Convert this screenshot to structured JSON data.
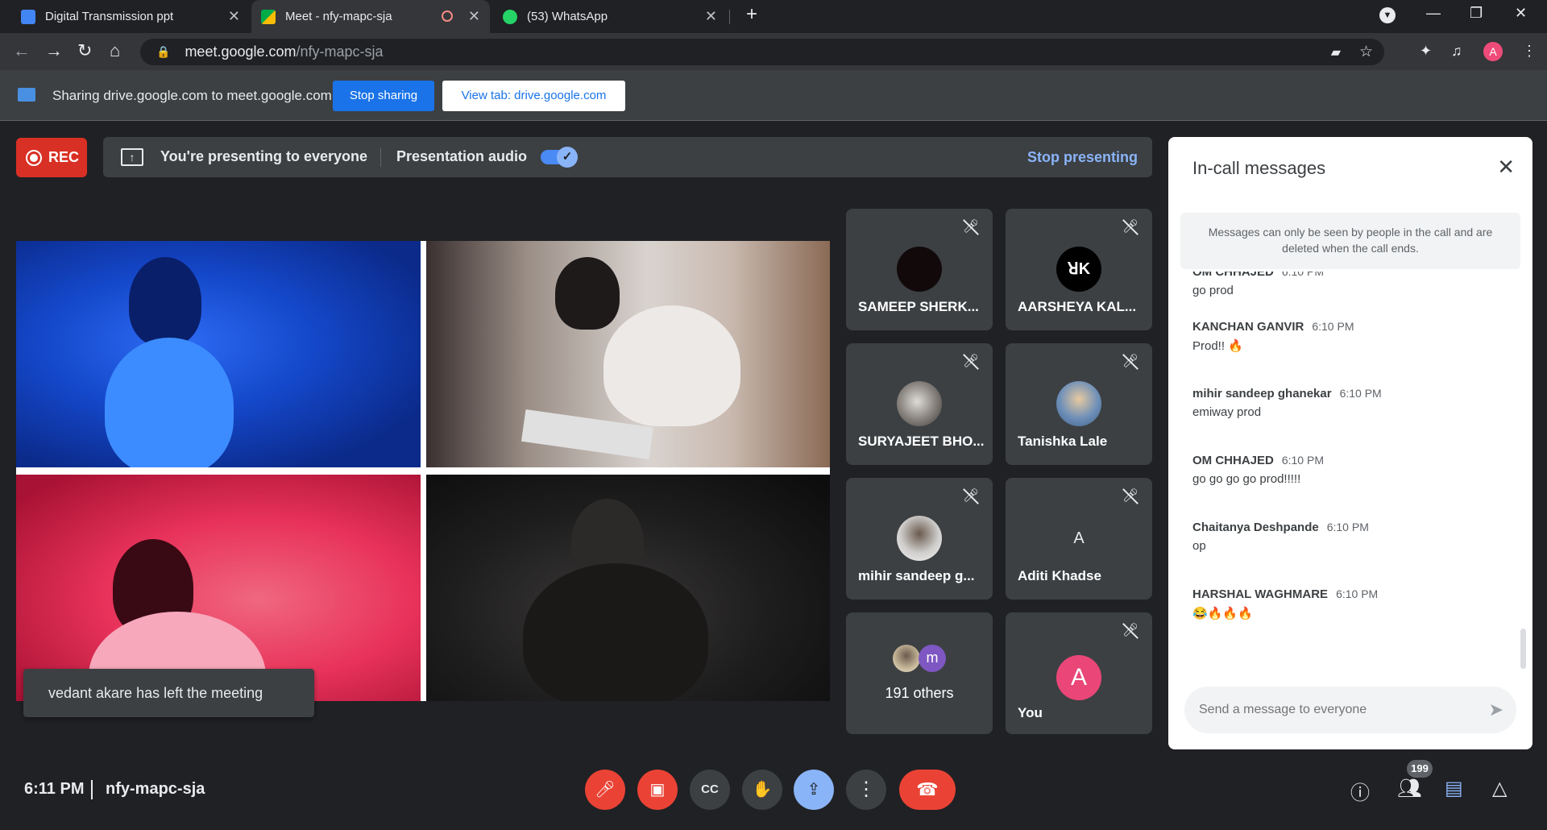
{
  "browser": {
    "tabs": [
      {
        "title": "Digital Transmission ppt",
        "favicon_color": "#4285f4"
      },
      {
        "title": "Meet - nfy-mapc-sja",
        "favicon_color": "#00ac47"
      },
      {
        "title": "(53) WhatsApp",
        "favicon_color": "#25d366"
      }
    ],
    "new_tab": "+",
    "url_host": "meet.google.com",
    "url_path": "/nfy-mapc-sja",
    "profile_initial": "A"
  },
  "share_bar": {
    "message": "Sharing drive.google.com to meet.google.com",
    "stop_label": "Stop sharing",
    "view_label": "View tab: drive.google.com"
  },
  "presenting": {
    "rec_label": "REC",
    "status": "You're presenting to everyone",
    "audio_label": "Presentation audio",
    "audio_enabled": true,
    "stop_label": "Stop presenting"
  },
  "toast": "vedant akare has left the meeting",
  "participants": [
    {
      "name": "SAMEEP SHERK...",
      "muted": true,
      "avatar_color": "#120a0a"
    },
    {
      "name": "AARSHEYA KAL...",
      "muted": true,
      "avatar_color": "#000000",
      "avatar_text": "ꓤK"
    },
    {
      "name": "SURYAJEET BHO...",
      "muted": true,
      "avatar_color": "#8a8580"
    },
    {
      "name": "Tanishka Lale",
      "muted": true,
      "avatar_color": "#6d8fb8"
    },
    {
      "name": "mihir sandeep g...",
      "muted": true,
      "avatar_color": "#d0cfcd"
    },
    {
      "name": "Aditi Khadse",
      "muted": true,
      "avatar_color": "#3c4043",
      "avatar_text": "A"
    }
  ],
  "others": {
    "label": "191 others",
    "avatar_initial": "m"
  },
  "self_tile": {
    "name": "You",
    "initial": "A",
    "muted": true,
    "avatar_color": "#ea4678"
  },
  "chat": {
    "title": "In-call messages",
    "notice": "Messages can only be seen by people in the call and are deleted when the call ends.",
    "messages": [
      {
        "sender": "OM CHHAJED",
        "time": "6:10 PM",
        "text": "go prod"
      },
      {
        "sender": "KANCHAN GANVIR",
        "time": "6:10 PM",
        "text": "Prod!! 🔥"
      },
      {
        "sender": "mihir sandeep ghanekar",
        "time": "6:10 PM",
        "text": "emiway prod"
      },
      {
        "sender": "OM CHHAJED",
        "time": "6:10 PM",
        "text": "go go go go prod!!!!!"
      },
      {
        "sender": "Chaitanya Deshpande",
        "time": "6:10 PM",
        "text": "op"
      },
      {
        "sender": "HARSHAL WAGHMARE",
        "time": "6:10 PM",
        "text": "😂🔥🔥🔥"
      }
    ],
    "input_placeholder": "Send a message to everyone"
  },
  "bottom_bar": {
    "time": "6:11 PM",
    "meeting_code": "nfy-mapc-sja",
    "people_count": "199"
  }
}
